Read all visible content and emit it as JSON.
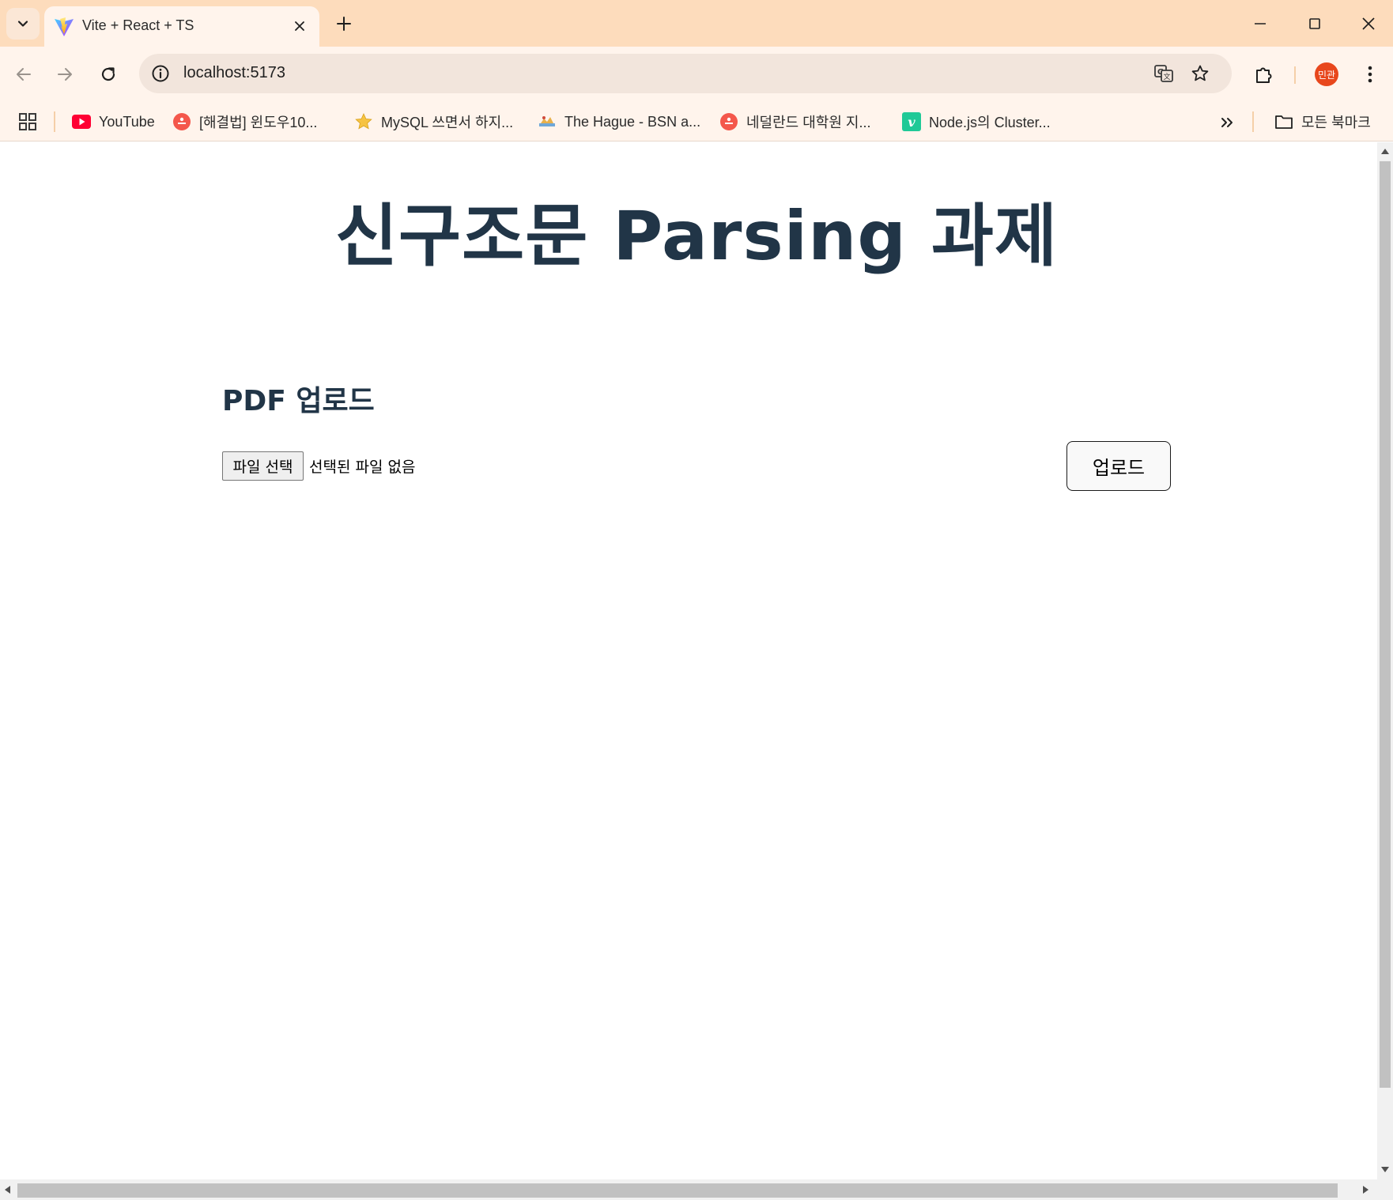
{
  "browser": {
    "tab": {
      "title": "Vite + React + TS"
    },
    "address_bar": {
      "url": "localhost:5173"
    },
    "profile": {
      "avatar_text": "민관",
      "color": "#e8471c"
    },
    "bookmarks": [
      {
        "label": "YouTube",
        "icon": "youtube-icon"
      },
      {
        "label": "[해결법] 윈도우10...",
        "icon": "site-icon"
      },
      {
        "label": "MySQL 쓰면서 하지...",
        "icon": "star-icon"
      },
      {
        "label": "The Hague - BSN a...",
        "icon": "site-icon"
      },
      {
        "label": "네덜란드 대학원 지...",
        "icon": "site-icon"
      },
      {
        "label": "Node.js의 Cluster...",
        "icon": "velog-icon"
      }
    ],
    "all_bookmarks_label": "모든 북마크"
  },
  "page": {
    "title": "신구조문 Parsing 과제",
    "section_title": "PDF 업로드",
    "file_button_label": "파일 선택",
    "file_status": "선택된 파일 없음",
    "upload_button_label": "업로드"
  },
  "colors": {
    "tab_strip": "#fddcbc",
    "toolbar": "#fff4ec",
    "heading": "#213547"
  }
}
